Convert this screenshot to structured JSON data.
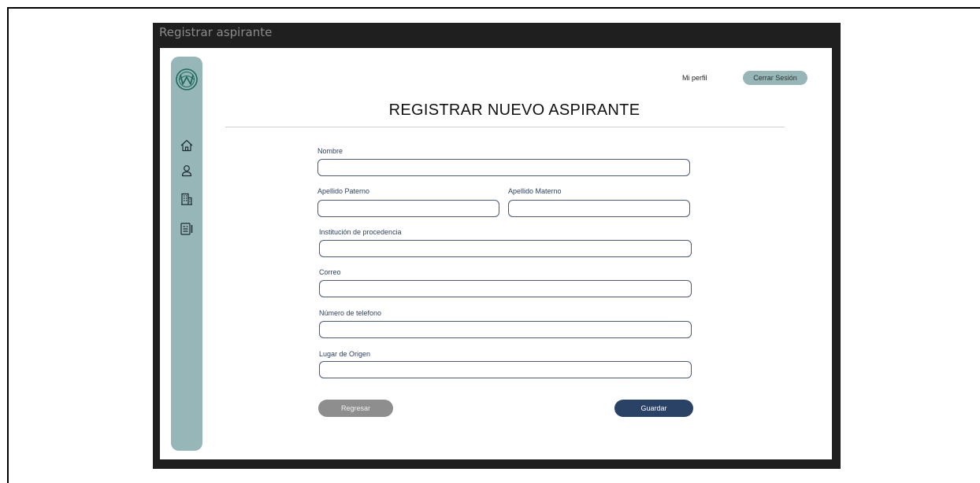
{
  "window": {
    "title": "Registrar aspirante"
  },
  "header": {
    "profile_label": "Mi perfil",
    "logout_label": "Cerrar Sesión"
  },
  "page": {
    "title": "REGISTRAR NUEVO ASPIRANTE"
  },
  "sidebar": {
    "logo": "university-logo-icon",
    "items": [
      {
        "icon": "home-icon"
      },
      {
        "icon": "user-icon"
      },
      {
        "icon": "building-icon"
      },
      {
        "icon": "id-card-icon"
      }
    ]
  },
  "form": {
    "nombre": {
      "label": "Nombre",
      "value": "",
      "placeholder": ""
    },
    "apellido_paterno": {
      "label": "Apellido Paterno",
      "value": "",
      "placeholder": ""
    },
    "apellido_materno": {
      "label": "Apellido Materno",
      "value": "",
      "placeholder": ""
    },
    "institucion": {
      "label": "Institución de procedencia",
      "value": "",
      "placeholder": ""
    },
    "correo": {
      "label": "Correo",
      "value": "",
      "placeholder": ""
    },
    "telefono": {
      "label": "Número de telefono",
      "value": "",
      "placeholder": ""
    },
    "lugar_origen": {
      "label": "Lugar de Origen",
      "value": "",
      "placeholder": ""
    }
  },
  "actions": {
    "back_label": "Regresar",
    "save_label": "Guardar"
  },
  "colors": {
    "sidebar": "#97b6b8",
    "primary": "#2a4265",
    "secondary": "#8e8e8e",
    "window_frame": "#1f1f1f"
  }
}
